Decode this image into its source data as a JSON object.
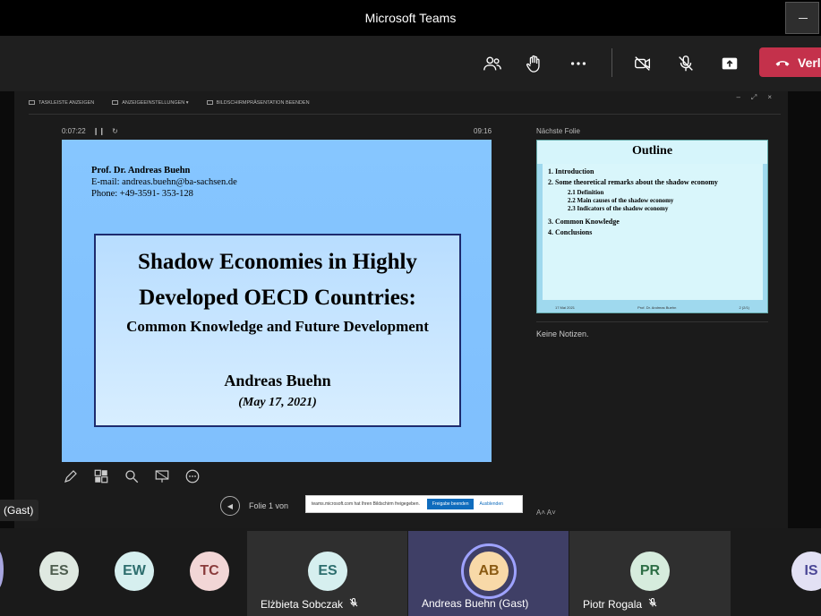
{
  "window": {
    "title": "Microsoft Teams"
  },
  "toolbar": {
    "leave_label": "Verl"
  },
  "ppt": {
    "menu": [
      "TASKLEISTE ANZEIGEN",
      "ANZEIGEEINSTELLUNGEN ▾",
      "BILDSCHIRMPRÄSENTATION BEENDEN"
    ],
    "elapsed": "0:07:22",
    "clock": "09:16",
    "next_label": "Nächste Folie",
    "notes": "Keine Notizen.",
    "slide_counter": "Folie 1 von",
    "font_controls": "A˄   A˅"
  },
  "slide": {
    "author": "Prof. Dr. Andreas Buehn",
    "email": "E-mail: andreas.buehn@ba-sachsen.de",
    "phone": "Phone: +49-3591- 353-128",
    "title_line1": "Shadow Economies in Highly",
    "title_line2": "Developed OECD Countries:",
    "subtitle": "Common Knowledge and Future Development",
    "presenter": "Andreas Buehn",
    "date": "(May 17, 2021)"
  },
  "next_slide": {
    "title": "Outline",
    "items": [
      "1.   Introduction",
      "2.   Some theoretical remarks about the shadow economy",
      "2.1   Definition",
      "2.2   Main causes of the shadow economy",
      "2.3   Indicators of the shadow economy",
      "3.   Common Knowledge",
      "4.   Conclusions"
    ],
    "footer_left": "17 Mai 2021",
    "footer_mid": "Prof. Dr. Andreas Buehn",
    "footer_right": "2 (2/1)"
  },
  "share_bar": {
    "text": "teams.microsoft.com hat Ihren Bildschirm freigegeben.",
    "stop": "Freigabe beenden",
    "hide": "Ausblenden"
  },
  "gast_label": "(Gast)",
  "participants": [
    {
      "initials": "ES",
      "name": "",
      "color": "#dfe9e1",
      "text": "#4e5e4f"
    },
    {
      "initials": "EW",
      "name": "",
      "color": "#d6efef",
      "text": "#2d6e6e"
    },
    {
      "initials": "TC",
      "name": "",
      "color": "#f2d6d6",
      "text": "#8a3b3b"
    },
    {
      "initials": "ES",
      "name": "Elżbieta Sobczak",
      "color": "#d6efef",
      "text": "#2d6e6e"
    },
    {
      "initials": "AB",
      "name": "Andreas Buehn (Gast)",
      "color": "#f8d9a8",
      "text": "#8a5a12"
    },
    {
      "initials": "PR",
      "name": "Piotr Rogala",
      "color": "#d6ecdd",
      "text": "#2d6e45"
    },
    {
      "initials": "IS",
      "name": "",
      "color": "#e3e1f4",
      "text": "#4b4796"
    }
  ]
}
